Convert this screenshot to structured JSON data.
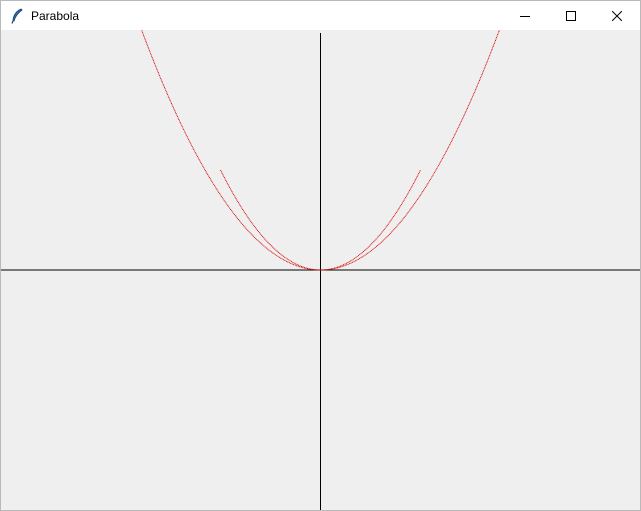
{
  "window": {
    "title": "Parabola",
    "app_icon": "feather-icon",
    "controls": [
      "minimize-icon",
      "maximize-icon",
      "close-icon"
    ]
  },
  "canvas": {
    "background": "#efefef",
    "axis_color": "#000000",
    "curve_color": "#d40000",
    "curves": [
      {
        "a": 0.0075,
        "x_range": [
          -200,
          200
        ]
      },
      {
        "a": 0.01,
        "x_range": [
          -100,
          100
        ]
      }
    ]
  }
}
